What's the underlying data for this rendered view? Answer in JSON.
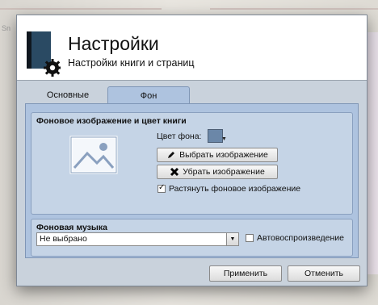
{
  "background": {
    "text": "Sn"
  },
  "header": {
    "title": "Настройки",
    "subtitle": "Настройки книги и страниц"
  },
  "tabs": [
    {
      "label": "Основные",
      "selected": false
    },
    {
      "label": "Фон",
      "selected": true
    }
  ],
  "background_group": {
    "title": "Фоновое изображение и цвет книги",
    "color_label": "Цвет фона:",
    "color_value": "#6b87a8",
    "choose_label": "Выбрать изображение",
    "remove_label": "Убрать изображение",
    "stretch_label": "Растянуть фоновое изображение",
    "stretch_checked": true
  },
  "music_group": {
    "title": "Фоновая музыка",
    "selected": "Не выбрано",
    "autoplay_label": "Автовоспроизведение",
    "autoplay_checked": false
  },
  "footer": {
    "apply_label": "Применить",
    "cancel_label": "Отменить"
  },
  "icons": [
    "book-icon",
    "gear-icon",
    "image-icon",
    "pencil-icon",
    "close-x-icon",
    "chevron-down-icon"
  ]
}
